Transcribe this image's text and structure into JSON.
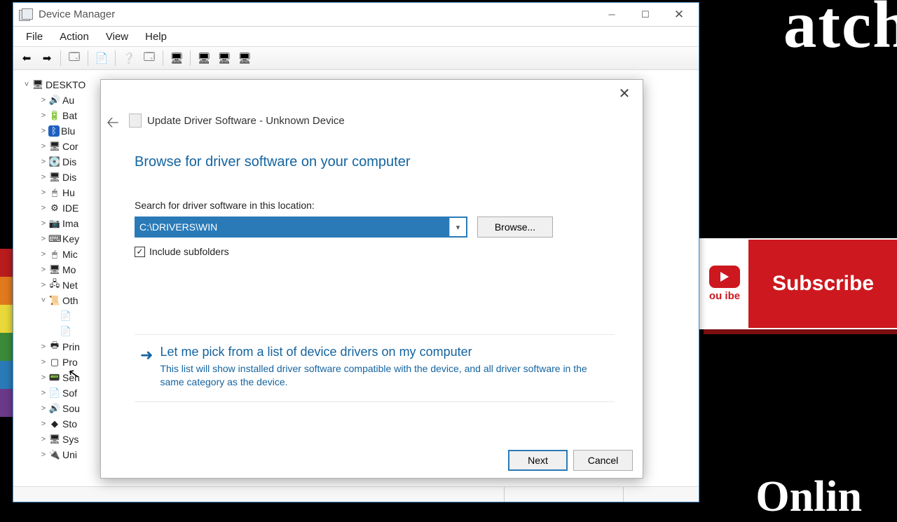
{
  "bg": {
    "top_text": "atch",
    "bottom_text": "Onlin",
    "subscribe": "Subscribe",
    "tube": "ou\nibe"
  },
  "window": {
    "title": "Device Manager",
    "menus": [
      "File",
      "Action",
      "View",
      "Help"
    ]
  },
  "tree": {
    "root": "DESKTO",
    "items": [
      {
        "label": "Au",
        "icon": "🔊"
      },
      {
        "label": "Bat",
        "icon": "🔋"
      },
      {
        "label": "Blu",
        "icon": "ᛒ",
        "iconbg": "#1f5fbf"
      },
      {
        "label": "Cor",
        "icon": "🖥"
      },
      {
        "label": "Dis",
        "icon": "💽"
      },
      {
        "label": "Dis",
        "icon": "🖥"
      },
      {
        "label": "Hu",
        "icon": "🖱"
      },
      {
        "label": "IDE",
        "icon": "⚙"
      },
      {
        "label": "Ima",
        "icon": "📷"
      },
      {
        "label": "Key",
        "icon": "⌨"
      },
      {
        "label": "Mic",
        "icon": "🖱"
      },
      {
        "label": "Mo",
        "icon": "🖥"
      },
      {
        "label": "Net",
        "icon": "🖧"
      },
      {
        "label": "Oth",
        "icon": "📜",
        "expanded": true
      },
      {
        "label": "Prin",
        "icon": "🖶"
      },
      {
        "label": "Pro",
        "icon": "▢"
      },
      {
        "label": "Sen",
        "icon": "📟"
      },
      {
        "label": "Sof",
        "icon": "📄"
      },
      {
        "label": "Sou",
        "icon": "🔊"
      },
      {
        "label": "Sto",
        "icon": "◆"
      },
      {
        "label": "Sys",
        "icon": "🖥"
      },
      {
        "label": "Uni",
        "icon": "🔌"
      }
    ]
  },
  "dialog": {
    "title": "Update Driver Software - Unknown Device",
    "heading": "Browse for driver software on your computer",
    "search_label": "Search for driver software in this location:",
    "path": "C:\\DRIVERS\\WIN",
    "browse": "Browse...",
    "include_sub": "Include subfolders",
    "pick_title": "Let me pick from a list of device drivers on my computer",
    "pick_desc": "This list will show installed driver software compatible with the device, and all driver software in the same category as the device.",
    "next": "Next",
    "cancel": "Cancel"
  }
}
